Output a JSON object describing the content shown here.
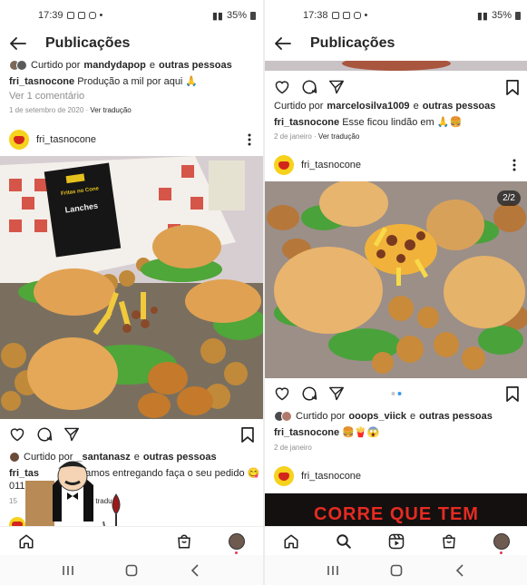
{
  "colors": {
    "accent": "#3897f0",
    "brand_avatar": "#f6d21c",
    "brand_red": "#d2261d",
    "notify": "#e53950"
  },
  "left": {
    "status": {
      "time": "17:39",
      "battery": "35%"
    },
    "header": {
      "title": "Publicações",
      "back_icon": "arrow-left-icon"
    },
    "prev_post": {
      "liked_prefix": "Curtido por",
      "liked_user": "mandydapop",
      "liked_joiner": "e",
      "liked_others": "outras pessoas",
      "caption_user": "fri_tasnocone",
      "caption_text": "Produção a mil por aqui 🙏",
      "comments": "Ver 1 comentário",
      "date": "1 de setembro de 2020",
      "translate": "Ver tradução"
    },
    "post": {
      "username": "fri_tasnocone",
      "sign_title": "Fritas no Cone",
      "sign_sub": "Lanches",
      "liked_prefix": "Curtido por",
      "liked_user": "_santanasz",
      "liked_joiner": "e",
      "liked_others": "outras pessoas",
      "caption_user": "fri_tas",
      "caption_text": "amos entregando faça o seu pedido 😋",
      "caption_line2": "011",
      "date_partial": "15",
      "translate_partial": "Ver tradu"
    }
  },
  "right": {
    "status": {
      "time": "17:38",
      "battery": "35%"
    },
    "header": {
      "title": "Publicações",
      "back_icon": "arrow-left-icon"
    },
    "prev_post": {
      "liked_prefix": "Curtido por",
      "liked_user": "marcelosilva1009",
      "liked_joiner": "e",
      "liked_others": "outras pessoas",
      "caption_user": "fri_tasnocone",
      "caption_text": "Esse ficou lindão em 🙏🍔",
      "date": "2 de janeiro",
      "translate": "Ver tradução"
    },
    "post": {
      "username": "fri_tasnocone",
      "badge": "2/2",
      "liked_prefix": "Curtido por",
      "liked_user": "ooops_viick",
      "liked_joiner": "e",
      "liked_others": "outras pessoas",
      "caption_user": "fri_tasnocone",
      "caption_text": "🍔🍟😱",
      "date": "2 de janeiro"
    },
    "next_post": {
      "username": "fri_tasnocone",
      "banner": "CORRE QUE TEM"
    }
  },
  "tabs": [
    "home-icon",
    "search-icon",
    "reels-icon",
    "shop-icon",
    "profile-avatar"
  ]
}
